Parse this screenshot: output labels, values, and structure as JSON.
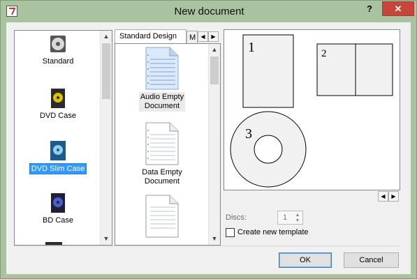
{
  "window": {
    "title": "New document",
    "help": "?",
    "close": "✕"
  },
  "left_list": {
    "items": [
      {
        "label": "Standard",
        "icon": "cd-disc-icon",
        "selected": false
      },
      {
        "label": "DVD Case",
        "icon": "dvd-case-icon",
        "selected": false
      },
      {
        "label": "DVD Slim Case",
        "icon": "dvd-slim-case-icon",
        "selected": true
      },
      {
        "label": "BD Case",
        "icon": "bd-case-icon",
        "selected": false
      }
    ]
  },
  "tabs": {
    "active": "Standard Design",
    "inactive": "M"
  },
  "documents": [
    {
      "label_line1": "Audio Empty",
      "label_line2": "Document",
      "icon": "audio-document-icon"
    },
    {
      "label_line1": "Data Empty",
      "label_line2": "Document",
      "icon": "data-document-icon"
    },
    {
      "label_line1": "",
      "label_line2": "",
      "icon": "document-icon"
    }
  ],
  "preview": {
    "labels": [
      "1",
      "2",
      "3"
    ]
  },
  "discs": {
    "label": "Discs:",
    "value": "1"
  },
  "template": {
    "label": "Create new template",
    "checked": false
  },
  "buttons": {
    "ok": "OK",
    "cancel": "Cancel"
  },
  "colors": {
    "selection": "#3399ff",
    "titlebar": "#a9c3a1",
    "close": "#c7463c"
  }
}
